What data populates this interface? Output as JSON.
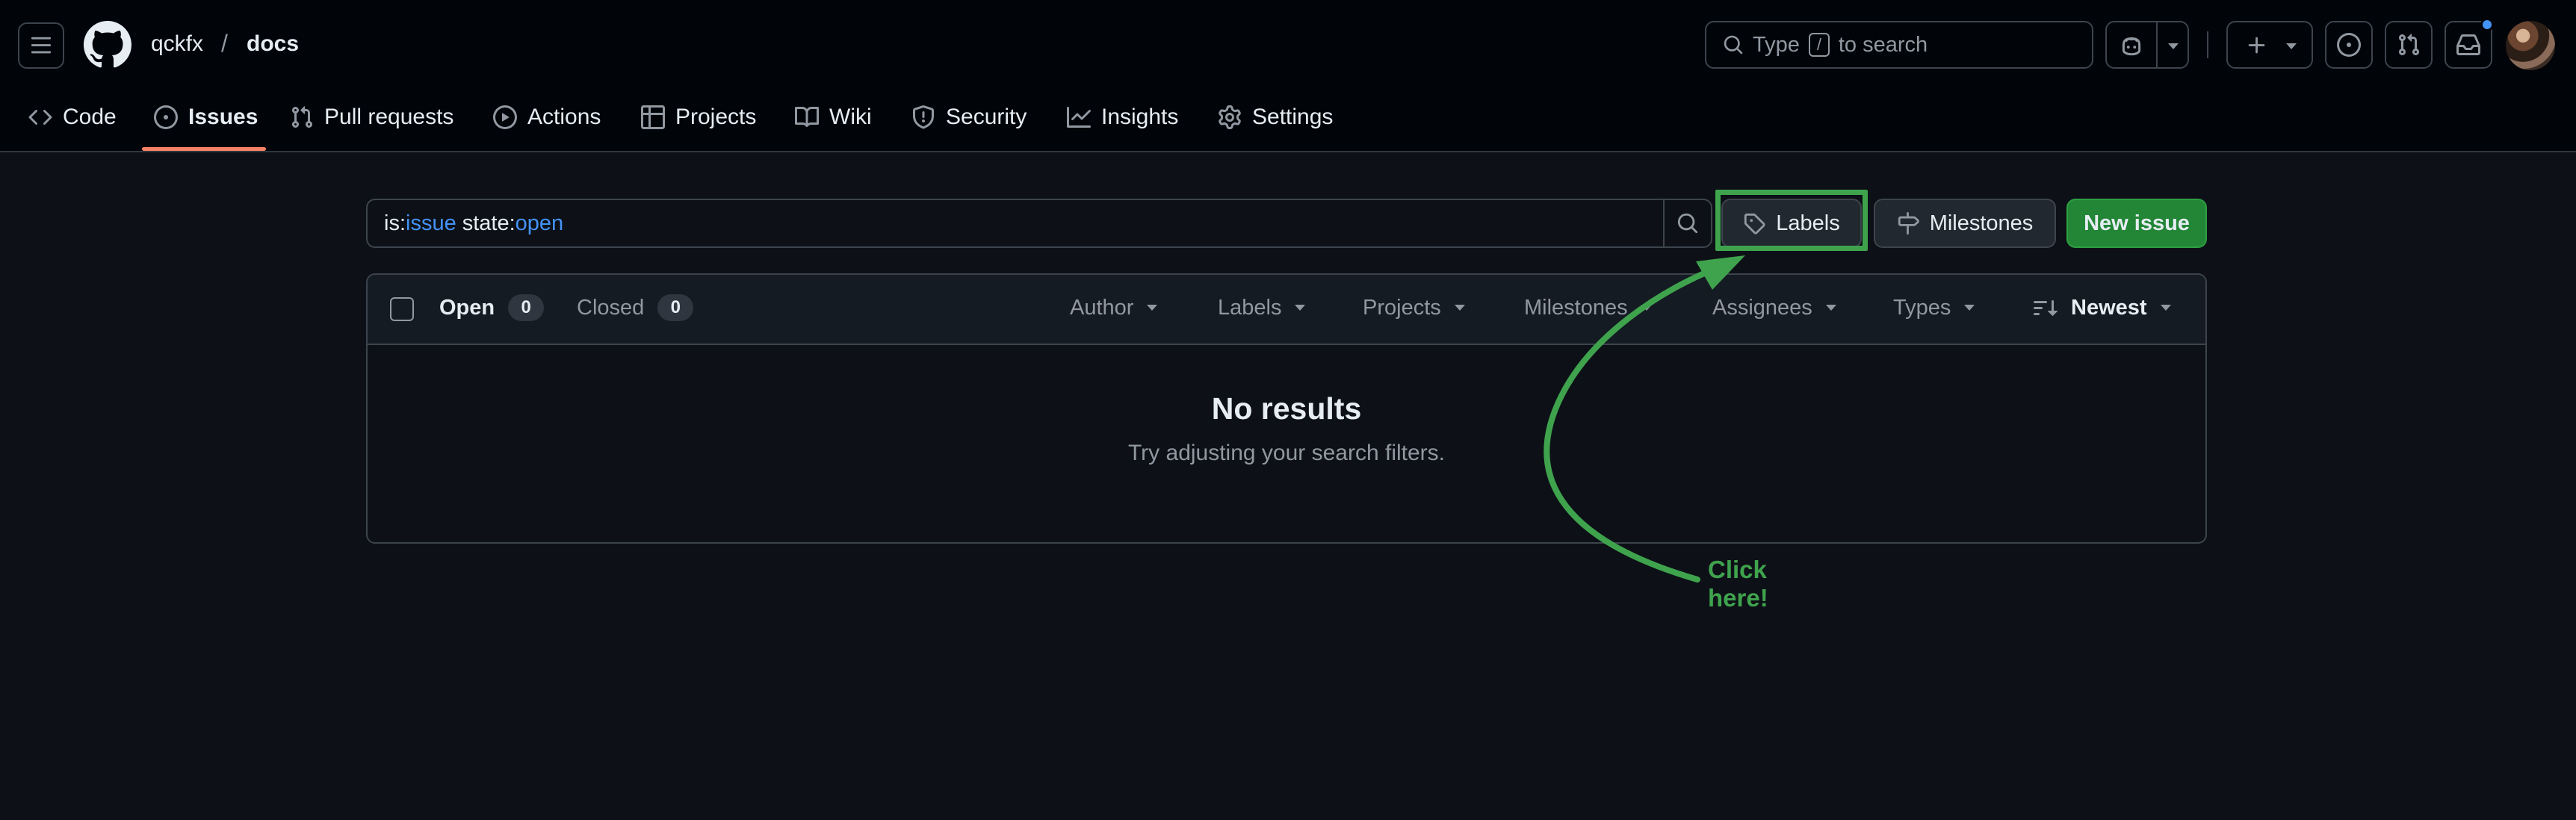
{
  "header": {
    "owner": "qckfx",
    "separator": "/",
    "repo": "docs",
    "search": {
      "pre": "Type",
      "key": "/",
      "post": "to search"
    }
  },
  "nav": {
    "tabs": [
      {
        "label": "Code"
      },
      {
        "label": "Issues"
      },
      {
        "label": "Pull requests"
      },
      {
        "label": "Actions"
      },
      {
        "label": "Projects"
      },
      {
        "label": "Wiki"
      },
      {
        "label": "Security"
      },
      {
        "label": "Insights"
      },
      {
        "label": "Settings"
      }
    ]
  },
  "filter": {
    "query_key1": "is:",
    "query_val1": "issue",
    "query_key2": "state:",
    "query_val2": "open"
  },
  "buttons": {
    "labels": "Labels",
    "milestones": "Milestones",
    "new_issue": "New issue"
  },
  "list": {
    "open_label": "Open",
    "open_count": "0",
    "closed_label": "Closed",
    "closed_count": "0",
    "filters": [
      "Author",
      "Labels",
      "Projects",
      "Milestones",
      "Assignees",
      "Types"
    ],
    "sort": "Newest",
    "empty_title": "No results",
    "empty_text": "Try adjusting your search filters."
  },
  "annotation": {
    "line1": "Click",
    "line2": "here!"
  },
  "colors": {
    "background": "#0d1117",
    "header": "#010409",
    "accent_tab": "#f78166",
    "primary_button": "#238636",
    "link_blue": "#4493f8",
    "annotation_green": "#3fa34d"
  }
}
